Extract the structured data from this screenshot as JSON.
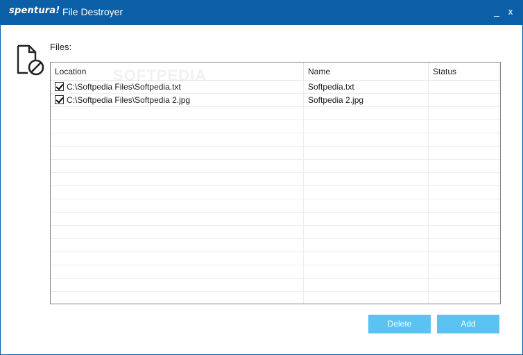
{
  "titlebar": {
    "brand": "spentura!",
    "app_title": "File Destroyer",
    "minimize_label": "_",
    "close_label": "x"
  },
  "main": {
    "files_label": "Files:",
    "watermark": "SOFTPEDIA",
    "columns": [
      "Location",
      "Name",
      "Status"
    ],
    "rows": [
      {
        "checked": true,
        "location": "C:\\Softpedia Files\\Softpedia.txt",
        "name": "Softpedia.txt",
        "status": ""
      },
      {
        "checked": true,
        "location": "C:\\Softpedia Files\\Softpedia 2.jpg",
        "name": "Softpedia 2.jpg",
        "status": ""
      }
    ],
    "empty_row_count": 15
  },
  "buttons": {
    "delete_label": "Delete",
    "add_label": "Add"
  },
  "colors": {
    "titlebar": "#0a5fa6",
    "button": "#5bc3f1"
  }
}
